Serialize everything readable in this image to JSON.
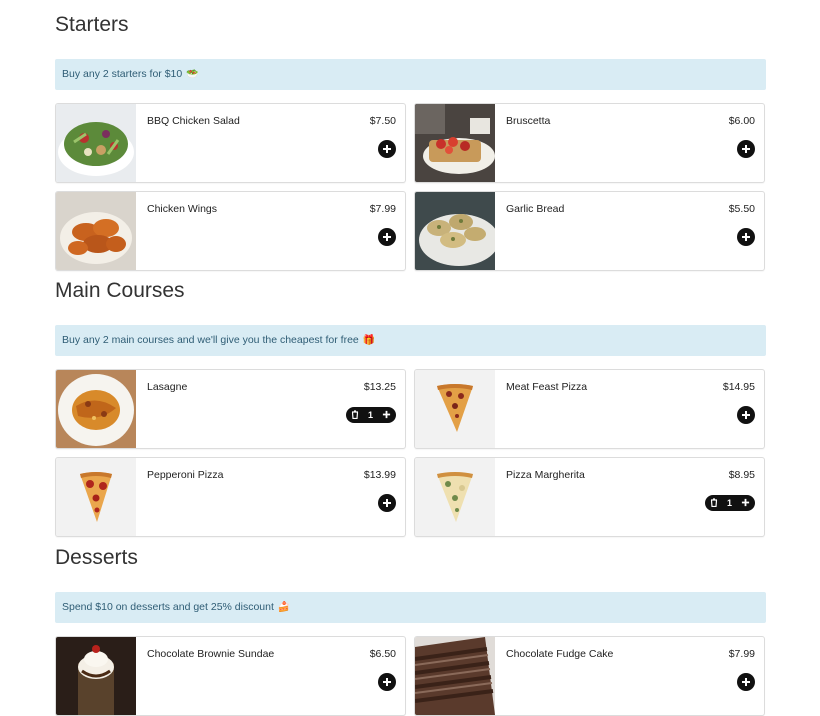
{
  "sections": [
    {
      "title": "Starters",
      "promo": "Buy any 2 starters for $10",
      "promo_emoji": "🥗",
      "items": [
        {
          "name": "BBQ Chicken Salad",
          "price": "$7.50"
        },
        {
          "name": "Bruscetta",
          "price": "$6.00"
        },
        {
          "name": "Chicken Wings",
          "price": "$7.99"
        },
        {
          "name": "Garlic Bread",
          "price": "$5.50"
        }
      ]
    },
    {
      "title": "Main Courses",
      "promo": "Buy any 2 main courses and we'll give you the cheapest for free",
      "promo_emoji": "🎁",
      "items": [
        {
          "name": "Lasagne",
          "price": "$13.25",
          "qty": "1"
        },
        {
          "name": "Meat Feast Pizza",
          "price": "$14.95"
        },
        {
          "name": "Pepperoni Pizza",
          "price": "$13.99"
        },
        {
          "name": "Pizza Margherita",
          "price": "$8.95",
          "qty": "1"
        }
      ]
    },
    {
      "title": "Desserts",
      "promo": "Spend $10 on desserts and get 25% discount",
      "promo_emoji": "🍰",
      "items": [
        {
          "name": "Chocolate Brownie Sundae",
          "price": "$6.50"
        },
        {
          "name": "Chocolate Fudge Cake",
          "price": "$7.99"
        }
      ]
    }
  ],
  "icons": {
    "add": "plus-icon",
    "remove": "trash-icon"
  },
  "colors": {
    "promo_bg": "#d9ecf4",
    "promo_text": "#2f5d75",
    "button": "#111111"
  }
}
